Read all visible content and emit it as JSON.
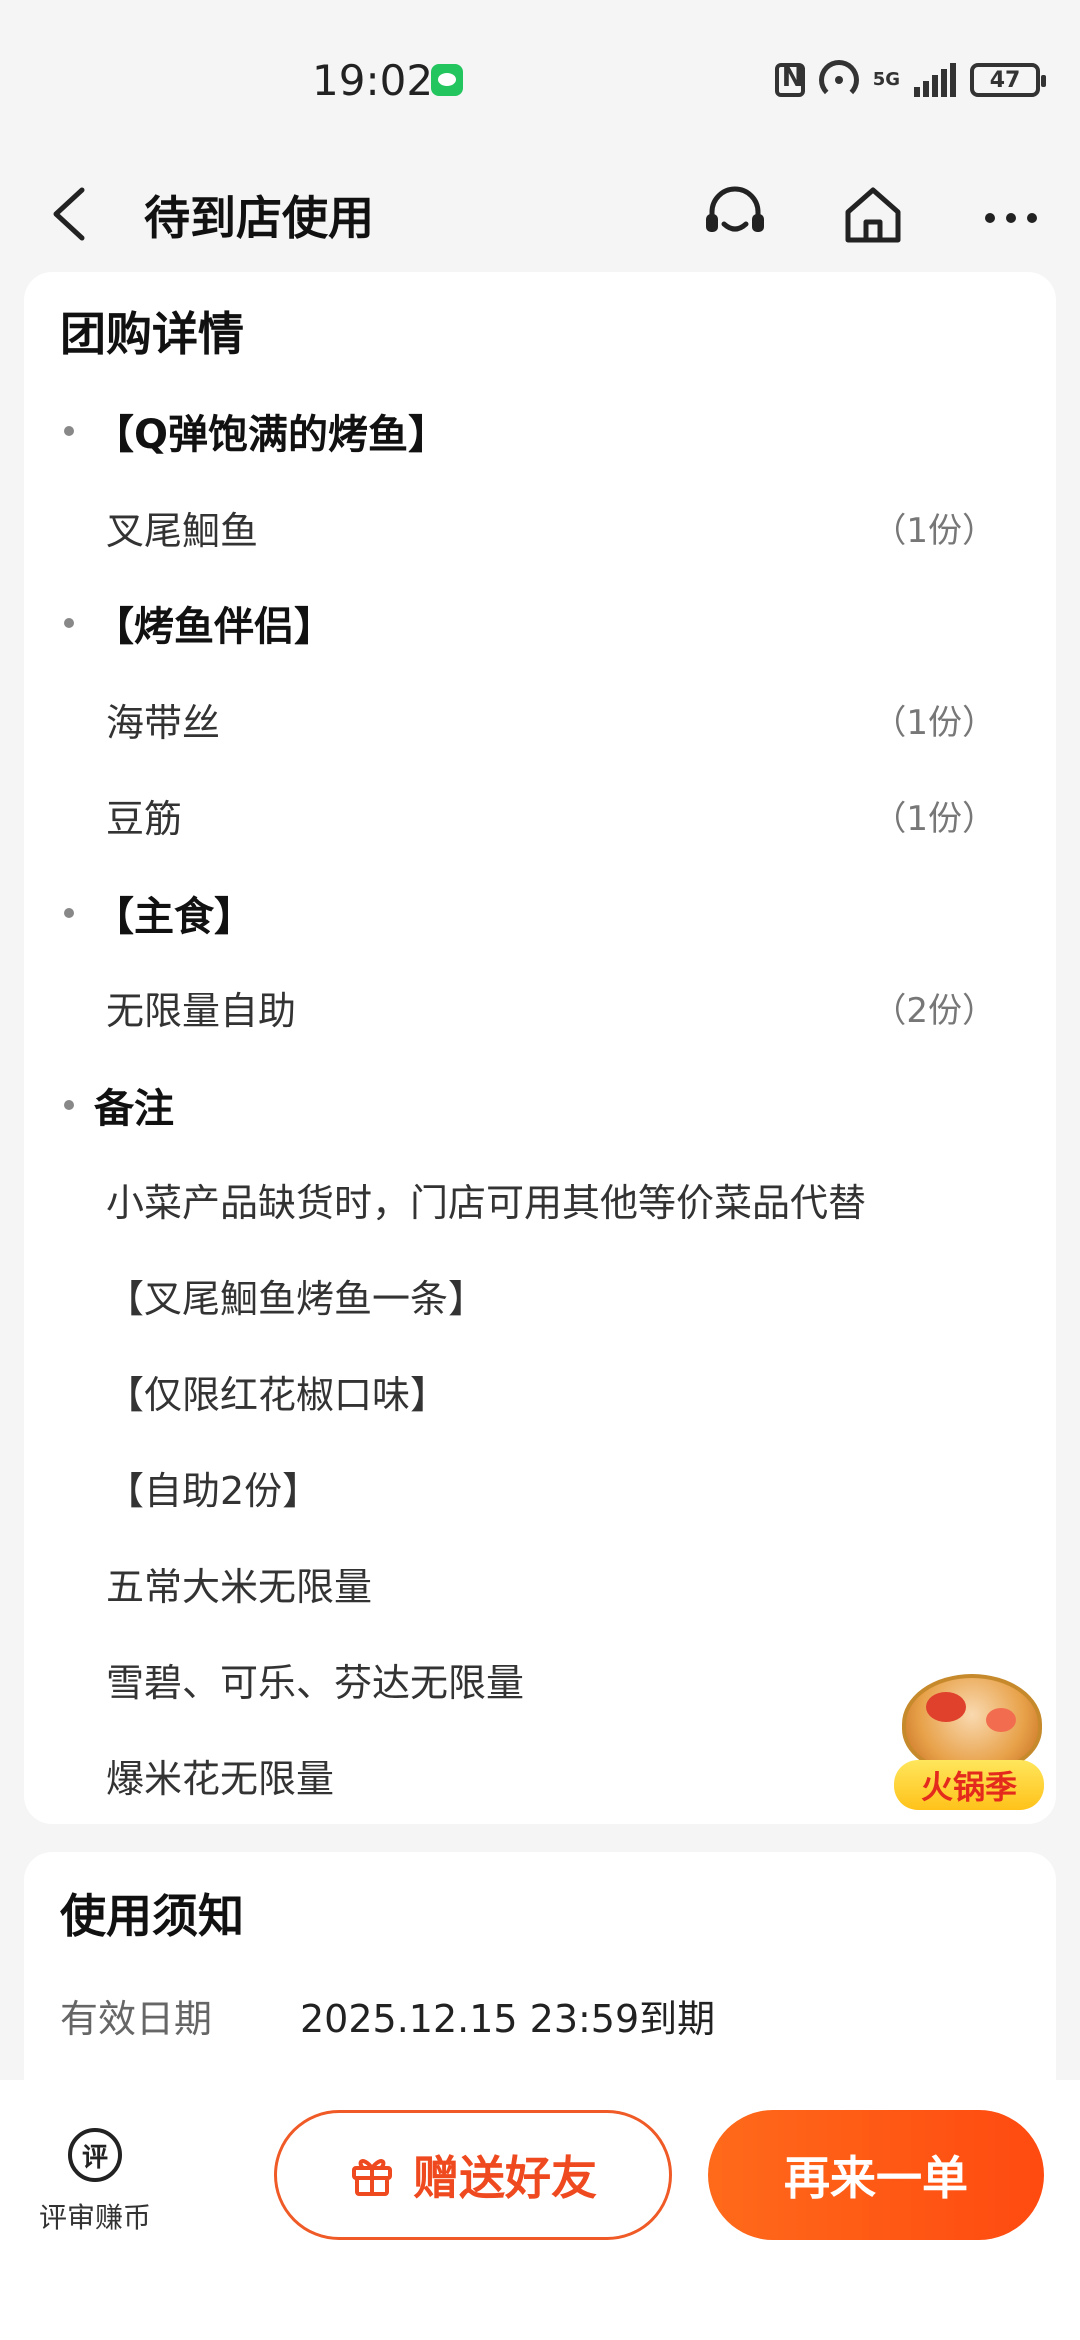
{
  "status_bar": {
    "time": "19:02",
    "network": "5G",
    "battery": "47",
    "icons": [
      "wechat-icon",
      "nfc-icon",
      "hotspot-icon",
      "signal-icon",
      "battery-icon"
    ]
  },
  "header": {
    "title": "待到店使用",
    "icons": [
      "back-icon",
      "customer-service-icon",
      "home-icon",
      "more-icon"
    ]
  },
  "deal_details": {
    "title": "团购详情",
    "sections": [
      {
        "title": "【Q弹饱满的烤鱼】",
        "items": [
          {
            "name": "叉尾鮰鱼",
            "qty": "（1份）"
          }
        ]
      },
      {
        "title": "【烤鱼伴侣】",
        "items": [
          {
            "name": "海带丝",
            "qty": "（1份）"
          },
          {
            "name": "豆筋",
            "qty": "（1份）"
          }
        ]
      },
      {
        "title": "【主食】",
        "items": [
          {
            "name": "无限量自助",
            "qty": "（2份）"
          }
        ]
      }
    ],
    "notes_title": "备注",
    "notes": [
      "小菜产品缺货时，门店可用其他等价菜品代替",
      "【叉尾鮰鱼烤鱼一条】",
      "【仅限红花椒口味】",
      "【自助2份】",
      "五常大米无限量",
      "雪碧、可乐、芬达无限量",
      "爆米花无限量"
    ]
  },
  "promo_badge": {
    "label": "火锅季"
  },
  "usage": {
    "title": "使用须知",
    "validity_label": "有效日期",
    "validity_value": "2025.12.15 23:59到期"
  },
  "bottom_bar": {
    "review_icon_text": "评",
    "review_label": "评审赚币",
    "gift_label": "赠送好友",
    "again_label": "再来一单"
  },
  "colors": {
    "accent": "#ff5a1a",
    "background": "#f5f5f5",
    "card": "#ffffff",
    "badge_text": "#e42a1c"
  }
}
